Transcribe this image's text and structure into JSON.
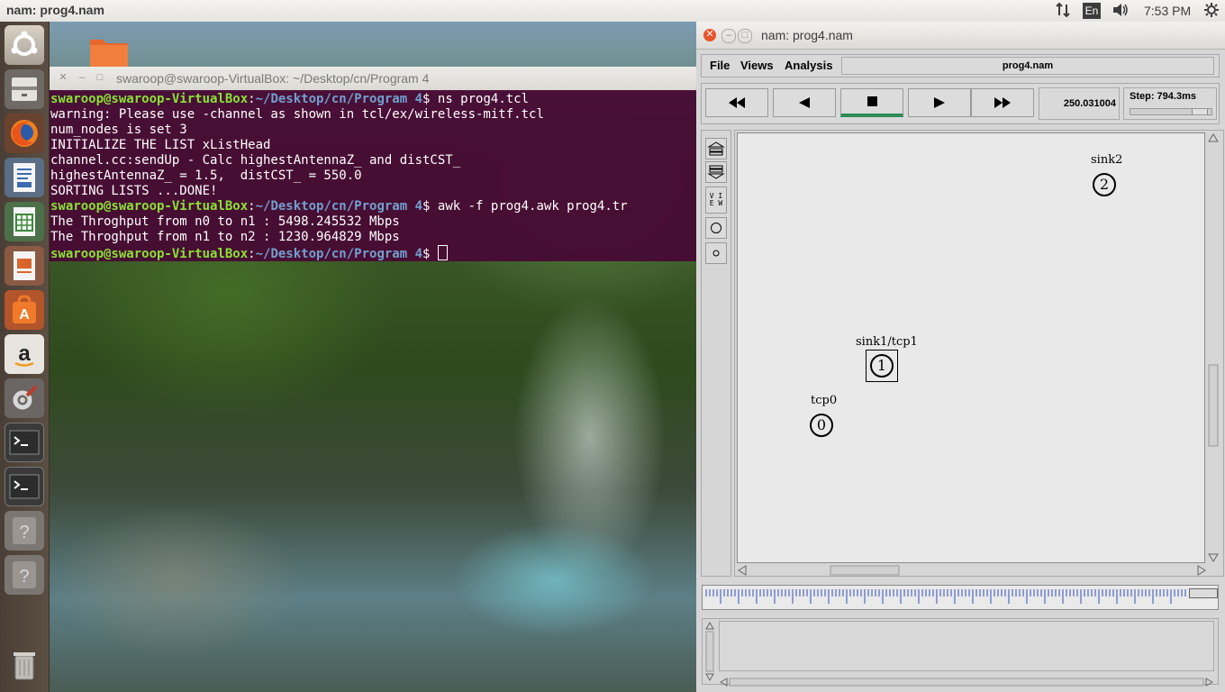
{
  "top_panel": {
    "title": "nam: prog4.nam",
    "keyboard": "En",
    "time": "7:53 PM",
    "icons": [
      "network-arrows-icon",
      "volume-icon",
      "gear-icon"
    ]
  },
  "launcher": {
    "items": [
      "ubuntu-dash-icon",
      "files-icon",
      "firefox-icon",
      "writer-icon",
      "calc-icon",
      "impress-icon",
      "software-center-icon",
      "amazon-icon",
      "settings-icon",
      "terminal-icon",
      "terminal-icon",
      "unknown-app-icon",
      "unknown-app-icon",
      "trash-icon"
    ]
  },
  "terminal": {
    "title": "swaroop@swaroop-VirtualBox: ~/Desktop/cn/Program 4",
    "prompt_user": "swaroop@swaroop-VirtualBox",
    "prompt_sep": ":",
    "prompt_path": "~/Desktop/cn/Program 4",
    "prompt_end": "$ ",
    "cmd1": "ns prog4.tcl",
    "out1": "warning: Please use -channel as shown in tcl/ex/wireless-mitf.tcl",
    "out2": "num_nodes is set 3",
    "out3": "INITIALIZE THE LIST xListHead",
    "out4": "channel.cc:sendUp - Calc highestAntennaZ_ and distCST_",
    "out5": "highestAntennaZ_ = 1.5,  distCST_ = 550.0",
    "out6": "SORTING LISTS ...DONE!",
    "cmd2": "awk -f prog4.awk prog4.tr",
    "out7": "The Throghput from n0 to n1 : 5498.245532 Mbps",
    "out8": "The Throghput from n1 to n2 : 1230.964829 Mbps"
  },
  "nam": {
    "title": "nam: prog4.nam",
    "menu": {
      "file": "File",
      "views": "Views",
      "analysis": "Analysis"
    },
    "file_name": "prog4.nam",
    "time_value": "250.031004",
    "step_label": "Step: 794.3ms",
    "step_fraction": 0.92,
    "tool_view_label": "V I E W",
    "nodes": [
      {
        "id": "0",
        "label": "tcp0"
      },
      {
        "id": "1",
        "label": "sink1/tcp1"
      },
      {
        "id": "2",
        "label": "sink2"
      }
    ]
  }
}
